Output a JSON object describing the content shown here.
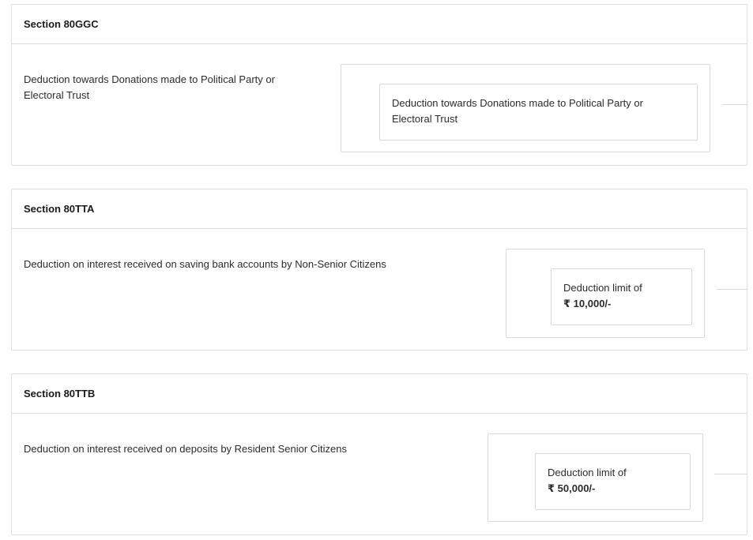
{
  "sections": [
    {
      "title": "Section 80GGC",
      "description_line1": "Deduction towards Donations made to Political Party or",
      "description_line2": "Electoral Trust",
      "box_line1": "Deduction towards Donations made to Political Party or",
      "box_line2": "Electoral Trust"
    },
    {
      "title": "Section 80TTA",
      "description_line1": "Deduction on interest received on saving bank accounts by Non-Senior Citizens",
      "box_line1": "Deduction limit of",
      "box_amount": "₹ 10,000/-"
    },
    {
      "title": "Section 80TTB",
      "description_line1": "Deduction on interest received on deposits by Resident Senior Citizens",
      "box_line1": "Deduction limit of",
      "box_amount": "₹ 50,000/-"
    }
  ],
  "colors": {
    "border": "#dcdfe6",
    "text": "#2b2b2b",
    "heading": "#1a1a1a"
  }
}
